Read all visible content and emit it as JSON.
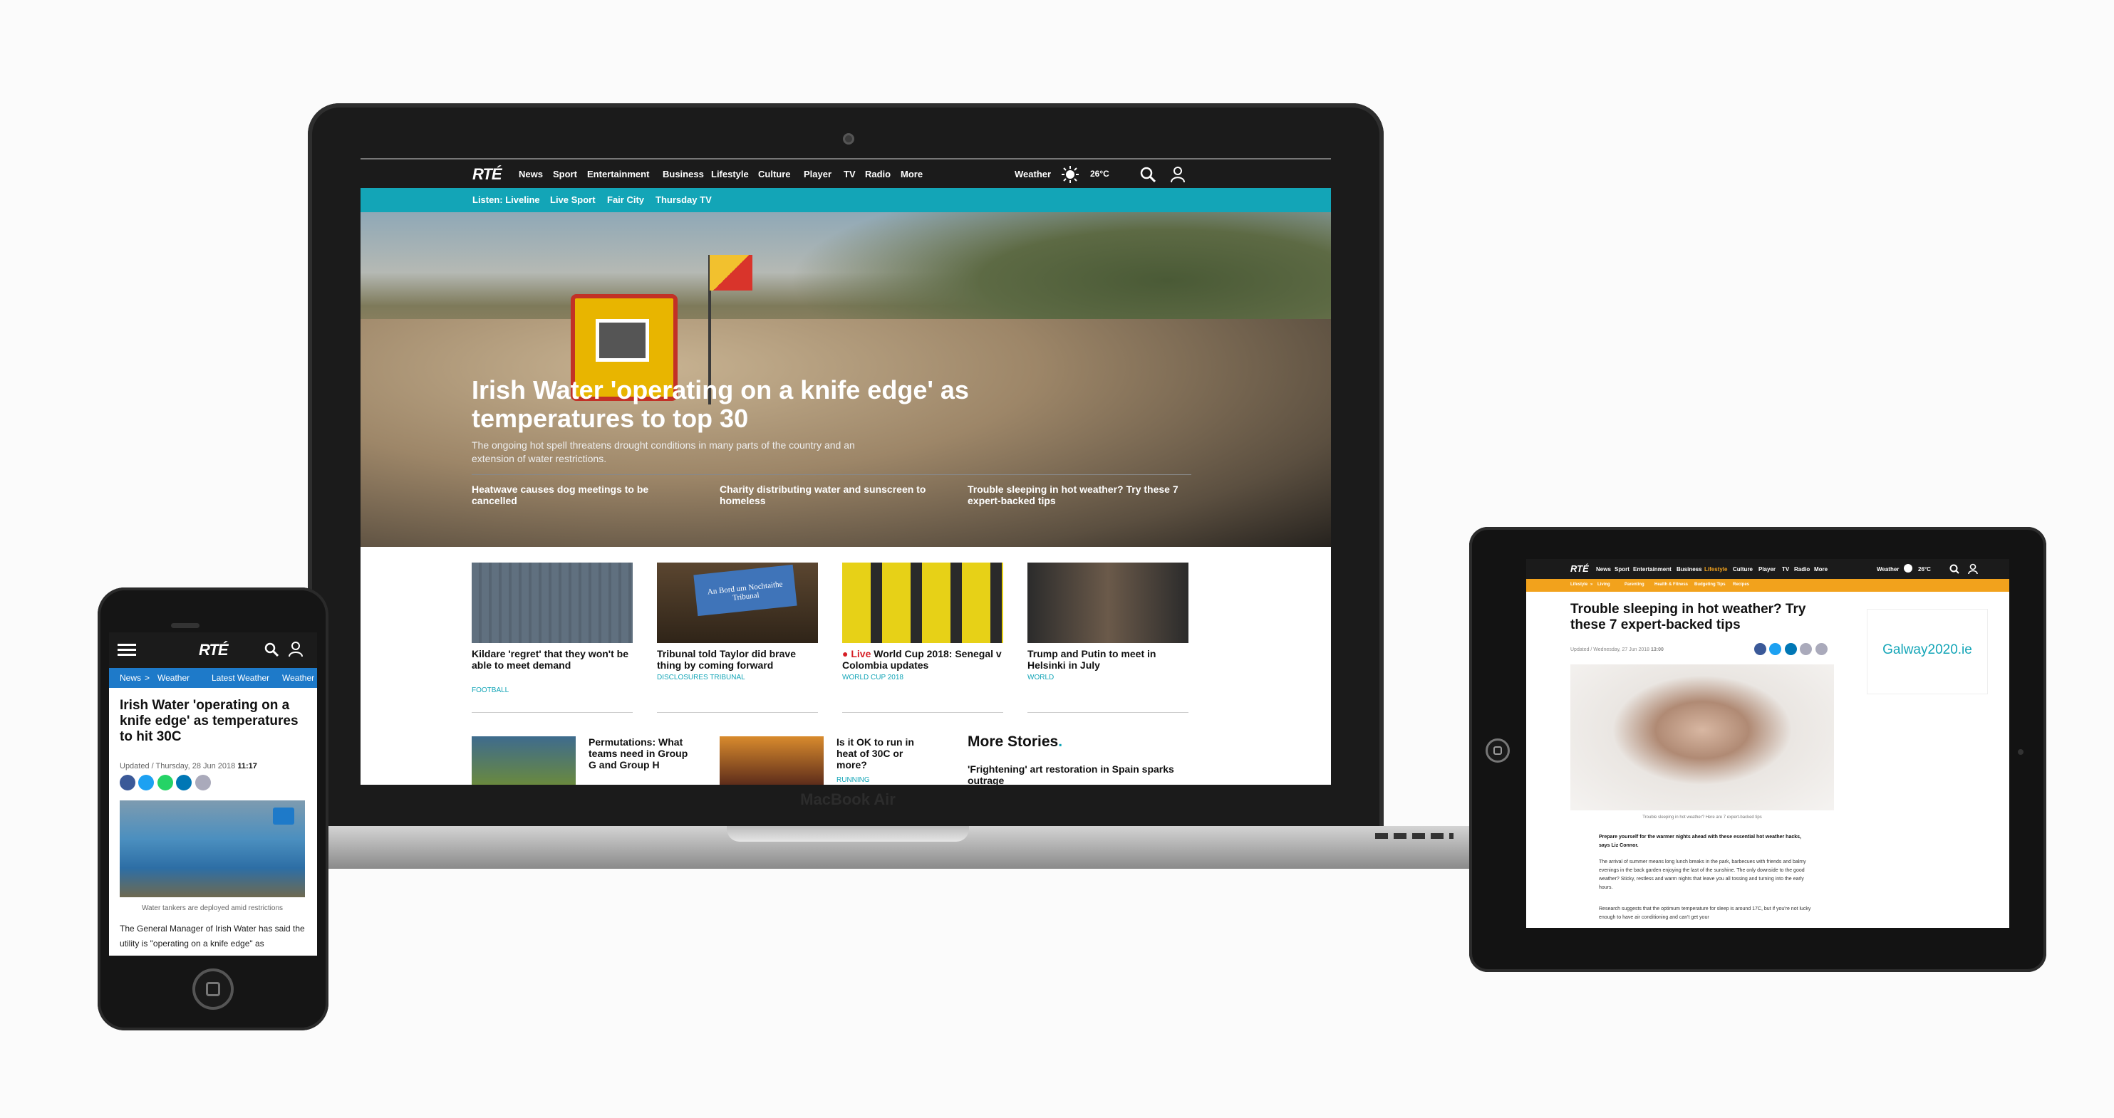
{
  "laptop": {
    "brand": "MacBook Air",
    "site": {
      "logo": "RTÉ",
      "nav": [
        "News",
        "Sport",
        "Entertainment",
        "Business",
        "Lifestyle",
        "Culture",
        "Player",
        "TV",
        "Radio",
        "More"
      ],
      "weather_label": "Weather",
      "weather_temp": "26°C",
      "sub_nav": [
        "Listen: Liveline",
        "Live Sport",
        "Fair City",
        "Thursday TV"
      ],
      "hero": {
        "title": "Irish Water 'operating on a knife edge' as temperatures to top 30",
        "subtitle": "The ongoing hot spell threatens drought conditions in many parts of the country and an extension of water restrictions.",
        "links": [
          "Heatwave causes dog meetings to be cancelled",
          "Charity distributing water and sunscreen to homeless",
          "Trouble sleeping in hot weather? Try these 7 expert-backed tips"
        ]
      },
      "cards": [
        {
          "title": "Kildare 'regret' that they won't be able to meet demand",
          "tag": "FOOTBALL"
        },
        {
          "title": "Tribunal told Taylor did brave thing by coming forward",
          "tag": "DISCLOSURES TRIBUNAL"
        },
        {
          "live": "● Live",
          "title": "World Cup 2018: Senegal v Colombia updates",
          "tag": "WORLD CUP 2018"
        },
        {
          "title": "Trump and Putin to meet in Helsinki in July",
          "tag": "WORLD"
        }
      ],
      "card_image_text": "An Bord um Nochtaithe Tribunal",
      "row2": [
        {
          "title": "Permutations: What teams need in Group G and Group H"
        },
        {
          "title": "Is it OK to run in heat of 30C or more?",
          "tag": "RUNNING"
        }
      ],
      "more_stories": {
        "heading": "More Stories",
        "first": "'Frightening' art restoration in Spain sparks outrage"
      }
    }
  },
  "phone": {
    "logo": "RTÉ",
    "breadcrumb": [
      "News",
      ">",
      "Weather",
      "Latest Weather",
      "Weather"
    ],
    "title": "Irish Water 'operating on a knife edge' as temperatures to hit 30C",
    "updated_prefix": "Updated / Thursday, 28 Jun 2018",
    "updated_time": "11:17",
    "caption": "Water tankers are deployed amid restrictions",
    "body": "The General Manager of Irish Water has said the utility is \"operating on a knife edge\" as"
  },
  "tablet": {
    "logo": "RTÉ",
    "nav": [
      "News",
      "Sport",
      "Entertainment",
      "Business",
      "Lifestyle",
      "Culture",
      "Player",
      "TV",
      "Radio",
      "More"
    ],
    "weather_label": "Weather",
    "weather_temp": "26°C",
    "sub_nav": [
      "Lifestyle",
      "»",
      "Living",
      "Parenting",
      "Health & Fitness",
      "Budgeting Tips",
      "Recipes"
    ],
    "title": "Trouble sleeping in hot weather? Try these 7 expert-backed tips",
    "updated": "Updated / Wednesday, 27 Jun 2018",
    "updated_time": "13:00",
    "ad": "Galway2020.ie",
    "caption": "Trouble sleeping in hot weather? Here are 7 expert-backed tips",
    "lede": "Prepare yourself for the warmer nights ahead with these essential hot weather hacks, says Liz Connor.",
    "para1": "The arrival of summer means long lunch breaks in the park, barbecues with friends and balmy evenings in the back garden enjoying the last of the sunshine. The only downside to the good weather? Sticky, restless and warm nights that leave you all tossing and turning into the early hours.",
    "para2": "Research suggests that the optimum temperature for sleep is around 17C, but if you're not lucky enough to have air conditioning and can't get your"
  },
  "colors": {
    "teal": "#13a5b7",
    "rte_blue": "#1e7ac9",
    "orange": "#f2a21c",
    "live_red": "#d61f26"
  },
  "icons": [
    "search-icon",
    "user-icon",
    "sun-icon",
    "menu-icon",
    "facebook-icon",
    "twitter-icon",
    "whatsapp-icon",
    "linkedin-icon",
    "email-icon"
  ]
}
